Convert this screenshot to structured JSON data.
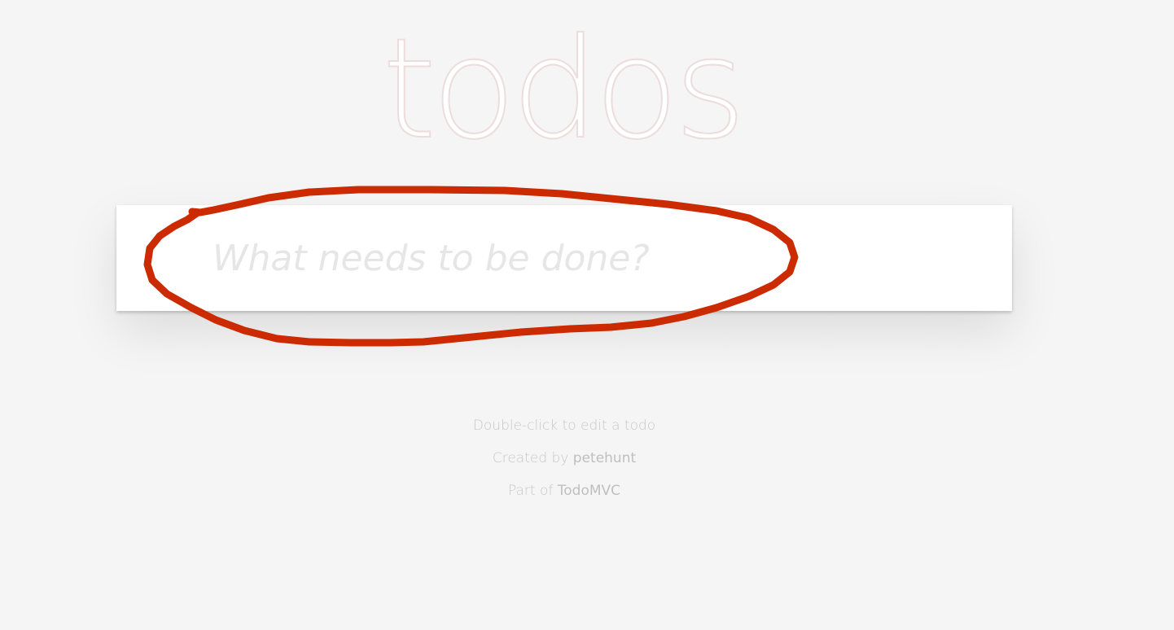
{
  "app": {
    "title": "todos"
  },
  "new_todo": {
    "placeholder": "What needs to be done?",
    "value": ""
  },
  "footer_info": {
    "hint": "Double-click to edit a todo",
    "created_by_prefix": "Created by ",
    "created_by_author": "petehunt",
    "part_of_prefix": "Part of ",
    "part_of_link": "TodoMVC"
  },
  "annotation": {
    "shape": "hand-drawn-ellipse",
    "color": "#cc2a00"
  }
}
